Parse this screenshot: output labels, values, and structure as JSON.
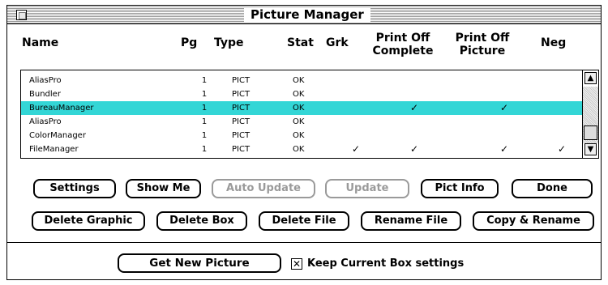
{
  "window": {
    "title": "Picture Manager"
  },
  "columns": {
    "name": "Name",
    "pg": "Pg",
    "type": "Type",
    "stat": "Stat",
    "grk": "Grk",
    "print_off_complete": [
      "Print Off",
      "Complete"
    ],
    "print_off_picture": [
      "Print Off",
      "Picture"
    ],
    "neg": "Neg"
  },
  "rows": [
    {
      "name": "AliasPro",
      "pg": "1",
      "type": "PICT",
      "stat": "OK",
      "grk": "",
      "complete": "",
      "picture": "",
      "neg": "",
      "selected": false
    },
    {
      "name": "Bundler",
      "pg": "1",
      "type": "PICT",
      "stat": "OK",
      "grk": "",
      "complete": "",
      "picture": "",
      "neg": "",
      "selected": false
    },
    {
      "name": "BureauManager",
      "pg": "1",
      "type": "PICT",
      "stat": "OK",
      "grk": "",
      "complete": "✓",
      "picture": "✓",
      "neg": "",
      "selected": true
    },
    {
      "name": "AliasPro",
      "pg": "1",
      "type": "PICT",
      "stat": "OK",
      "grk": "",
      "complete": "",
      "picture": "",
      "neg": "",
      "selected": false
    },
    {
      "name": "ColorManager",
      "pg": "1",
      "type": "PICT",
      "stat": "OK",
      "grk": "",
      "complete": "",
      "picture": "",
      "neg": "",
      "selected": false
    },
    {
      "name": "FileManager",
      "pg": "1",
      "type": "PICT",
      "stat": "OK",
      "grk": "✓",
      "complete": "✓",
      "picture": "✓",
      "neg": "✓",
      "selected": false
    }
  ],
  "scrollbar": {
    "up_icon": "up-arrow-icon",
    "down_icon": "down-arrow-icon"
  },
  "buttons": {
    "settings": "Settings",
    "show_me": "Show Me",
    "auto_update": "Auto Update",
    "update": "Update",
    "pict_info": "Pict Info",
    "done": "Done",
    "delete_graphic": "Delete Graphic",
    "delete_box": "Delete Box",
    "delete_file": "Delete File",
    "rename_file": "Rename File",
    "copy_rename": "Copy & Rename",
    "get_new_picture": "Get New Picture"
  },
  "keep_settings": {
    "label": "Keep Current Box settings",
    "checked": true,
    "mark": "✕"
  }
}
